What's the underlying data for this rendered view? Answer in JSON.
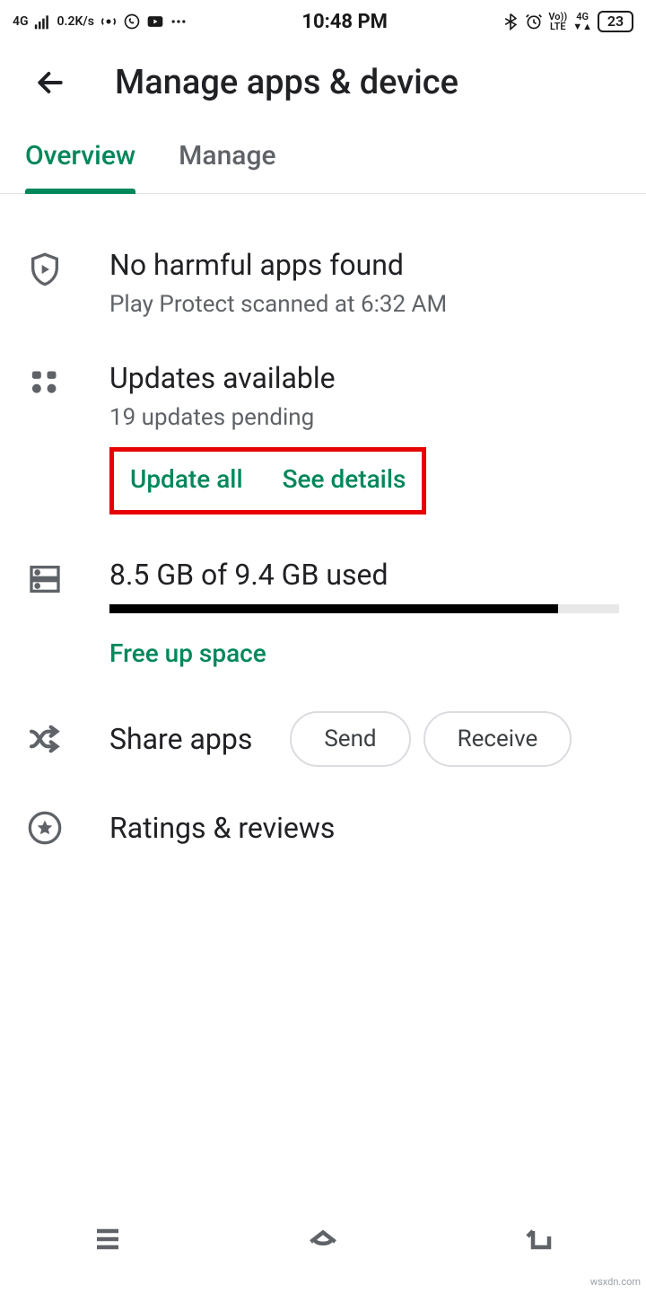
{
  "status_bar": {
    "network_type": "4G",
    "data_rate": "0.2K/s",
    "time": "10:48 PM",
    "volte": "Vo))",
    "lte": "LTE",
    "net2": "4G",
    "battery": "23"
  },
  "header": {
    "title": "Manage apps & device"
  },
  "tabs": {
    "items": [
      "Overview",
      "Manage"
    ],
    "active_index": 0
  },
  "protect": {
    "title": "No harmful apps found",
    "subtitle": "Play Protect scanned at 6:32 AM"
  },
  "updates": {
    "title": "Updates available",
    "subtitle": "19 updates pending",
    "update_all": "Update all",
    "see_details": "See details"
  },
  "storage": {
    "title": "8.5 GB of 9.4 GB used",
    "free_up": "Free up space",
    "percent_used": 88
  },
  "share": {
    "title": "Share apps",
    "send": "Send",
    "receive": "Receive"
  },
  "ratings": {
    "title": "Ratings & reviews"
  },
  "watermark": "wsxdn.com"
}
